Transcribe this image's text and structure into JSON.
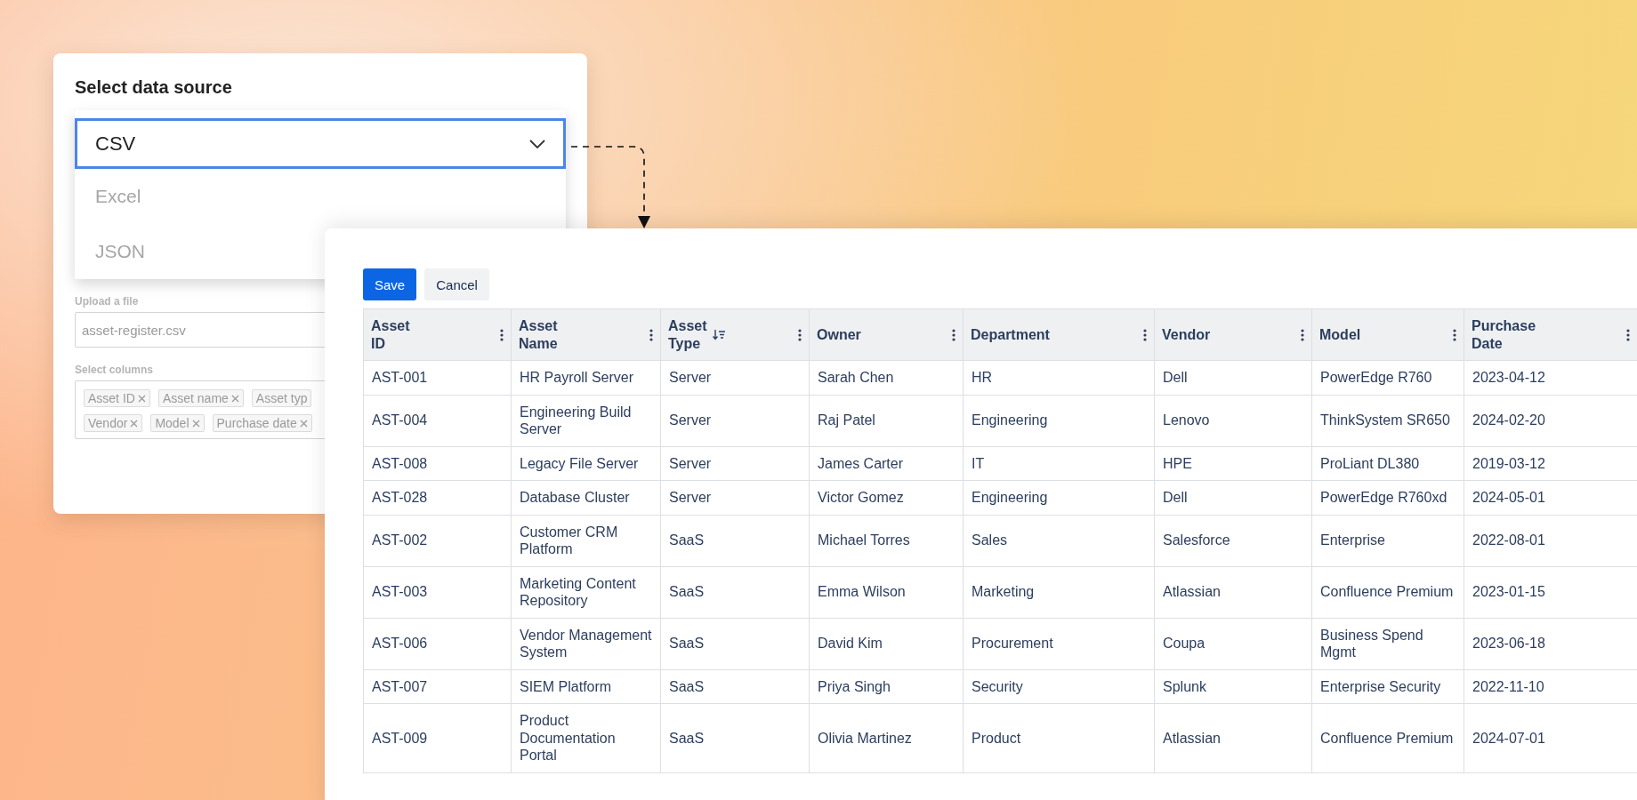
{
  "source_panel": {
    "title": "Select data source",
    "select": {
      "value": "CSV",
      "expanded": true,
      "options": [
        {
          "label": "Excel",
          "selected": false
        },
        {
          "label": "JSON",
          "selected": false
        }
      ]
    },
    "upload": {
      "label": "Upload a file",
      "value": "asset-register.csv"
    },
    "columns": {
      "label": "Select columns",
      "chips": [
        [
          "Asset ID",
          "Asset name",
          "Asset typ"
        ],
        [
          "Vendor",
          "Model",
          "Purchase date"
        ]
      ]
    }
  },
  "table_panel": {
    "buttons": [
      {
        "label": "Save",
        "kind": "primary"
      },
      {
        "label": "Cancel",
        "kind": "secondary"
      }
    ],
    "table": {
      "columns": [
        {
          "label": "Asset ID",
          "sorted": false
        },
        {
          "label": "Asset Name",
          "sorted": false
        },
        {
          "label": "Asset Type",
          "sorted": true
        },
        {
          "label": "Owner",
          "sorted": false
        },
        {
          "label": "Department",
          "sorted": false
        },
        {
          "label": "Vendor",
          "sorted": false
        },
        {
          "label": "Model",
          "sorted": false
        },
        {
          "label": "Purchase Date",
          "sorted": false
        }
      ],
      "rows": [
        [
          "AST-001",
          "HR Payroll Server",
          "Server",
          "Sarah Chen",
          "HR",
          "Dell",
          "PowerEdge R760",
          "2023-04-12"
        ],
        [
          "AST-004",
          "Engineering Build Server",
          "Server",
          "Raj Patel",
          "Engineering",
          "Lenovo",
          "ThinkSystem SR650",
          "2024-02-20"
        ],
        [
          "AST-008",
          "Legacy File Server",
          "Server",
          "James Carter",
          "IT",
          "HPE",
          "ProLiant DL380",
          "2019-03-12"
        ],
        [
          "AST-028",
          "Database Cluster",
          "Server",
          "Victor Gomez",
          "Engineering",
          "Dell",
          "PowerEdge R760xd",
          "2024-05-01"
        ],
        [
          "AST-002",
          "Customer CRM Platform",
          "SaaS",
          "Michael Torres",
          "Sales",
          "Salesforce",
          "Enterprise",
          "2022-08-01"
        ],
        [
          "AST-003",
          "Marketing Content Repository",
          "SaaS",
          "Emma Wilson",
          "Marketing",
          "Atlassian",
          "Confluence Premium",
          "2023-01-15"
        ],
        [
          "AST-006",
          "Vendor Management System",
          "SaaS",
          "David Kim",
          "Procurement",
          "Coupa",
          "Business Spend Mgmt",
          "2023-06-18"
        ],
        [
          "AST-007",
          "SIEM Platform",
          "SaaS",
          "Priya Singh",
          "Security",
          "Splunk",
          "Enterprise Security",
          "2022-11-10"
        ],
        [
          "AST-009",
          "Product Documentation Portal",
          "SaaS",
          "Olivia Martinez",
          "Product",
          "Atlassian",
          "Confluence Premium",
          "2024-07-01"
        ]
      ]
    }
  }
}
